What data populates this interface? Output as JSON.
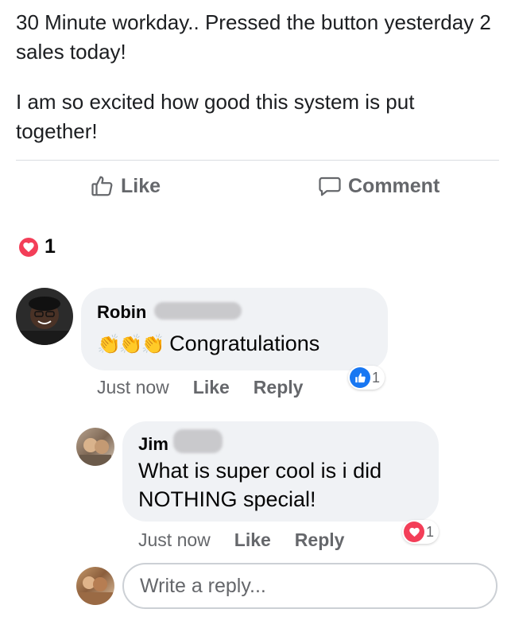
{
  "post": {
    "paragraphs": [
      "30 Minute workday.. Pressed the button yesterday 2 sales today!",
      "I am so excited how good this system is put together!"
    ]
  },
  "actions": {
    "like_label": "Like",
    "comment_label": "Comment"
  },
  "reactions": {
    "icon": "heart-icon",
    "count": "1"
  },
  "comments": [
    {
      "author": "Robin",
      "body": "Congratulations",
      "emoji": "👏👏👏",
      "time": "Just now",
      "like_label": "Like",
      "reply_label": "Reply",
      "reaction_icon": "like-icon",
      "reaction_count": "1"
    },
    {
      "author": "Jim",
      "body": "What is super cool is i did NOTHING special!",
      "time": "Just now",
      "like_label": "Like",
      "reply_label": "Reply",
      "reaction_icon": "heart-icon",
      "reaction_count": "1"
    }
  ],
  "reply_box": {
    "placeholder": "Write a reply..."
  },
  "colors": {
    "like_blue": "#1877f2",
    "heart_red": "#f33e58",
    "bubble_bg": "#f0f2f5",
    "muted_text": "#65676b"
  }
}
